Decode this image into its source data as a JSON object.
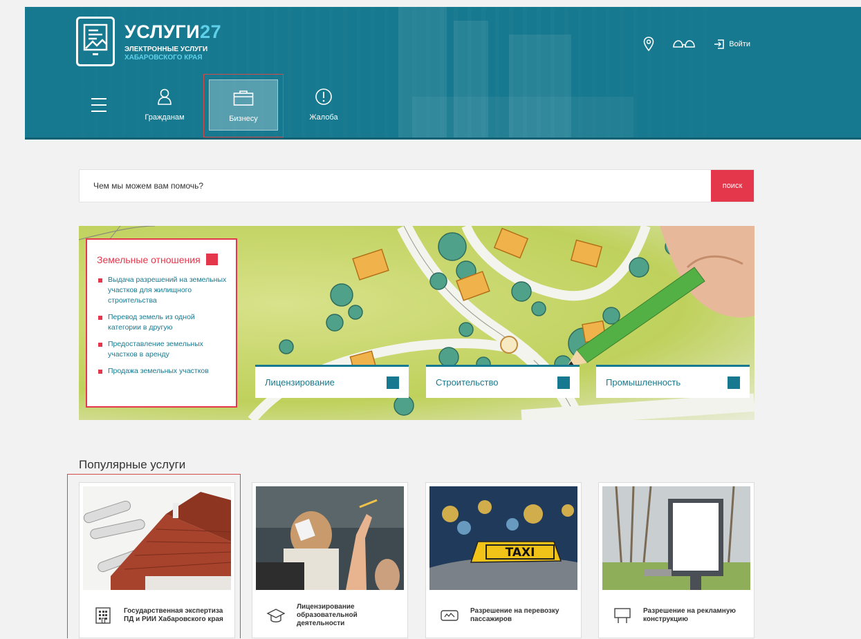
{
  "header": {
    "logo_title": "УСЛУГИ",
    "logo_number": "27",
    "logo_sub1": "ЭЛЕКТРОННЫЕ УСЛУГИ",
    "logo_sub2": "ХАБАРОВСКОГО КРАЯ",
    "login_label": "Войти",
    "icons": [
      "location-icon",
      "glasses-icon",
      "login-icon"
    ]
  },
  "nav": {
    "items": [
      {
        "label": "Гражданам",
        "icon": "user-icon"
      },
      {
        "label": "Бизнесу",
        "icon": "briefcase-icon",
        "active": true
      },
      {
        "label": "Жалоба",
        "icon": "exclamation-icon"
      }
    ]
  },
  "search": {
    "placeholder": "Чем мы можем вам помочь?",
    "button_label": "поиск"
  },
  "banner": {
    "feature": {
      "title": "Земельные отношения",
      "items": [
        "Выдача разрешений на земельных участков для жилищного строительства",
        "Перевод земель из одной категории в другую",
        "Предоставление земельных участков в аренду",
        "Продажа земельных участков"
      ]
    },
    "categories": [
      "Лицензирование",
      "Строительство",
      "Промышленность"
    ]
  },
  "popular": {
    "title": "Популярные услуги",
    "cards": [
      {
        "label": "Государственная экспертиза ПД и РИИ Хабаровского края",
        "icon": "building-icon"
      },
      {
        "label": "Лицензирование образовательной деятельности",
        "icon": "graduation-cap-icon"
      },
      {
        "label": "Разрешение на перевозку пассажиров",
        "icon": "taxi-icon"
      },
      {
        "label": "Разрешение на рекламную конструкцию",
        "icon": "billboard-icon"
      }
    ],
    "taxi_sign": "TAXI"
  },
  "colors": {
    "brand_teal": "#17798f",
    "accent_red": "#e4374b",
    "logo_accent": "#5fd0ea"
  }
}
